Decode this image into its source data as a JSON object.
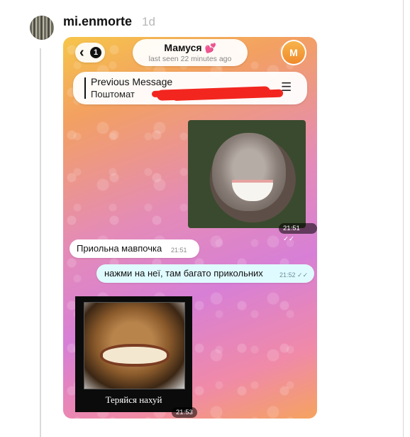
{
  "post": {
    "username": "mi.enmorte",
    "age": "1d"
  },
  "chat": {
    "back_badge": "1",
    "title": "Мамуся",
    "title_emoji": "💕",
    "last_seen": "last seen 22 minutes ago",
    "contact_initial": "M",
    "pinned": {
      "title": "Previous Message",
      "text": "Поштомат"
    },
    "messages": [
      {
        "type": "image",
        "direction": "in",
        "time": "21:51",
        "status": "read"
      },
      {
        "type": "text",
        "direction": "in",
        "text": "Приольна мавпочка",
        "time": "21:51"
      },
      {
        "type": "text",
        "direction": "out",
        "text": "нажми на неї, там багато прикольних",
        "time": "21:52",
        "status": "read"
      },
      {
        "type": "image",
        "direction": "in",
        "caption": "Теряйся нахуй",
        "time": "21:53"
      }
    ]
  },
  "colors": {
    "outgoing_bubble": "#e0fbff",
    "incoming_bubble": "#ffffff",
    "contact_avatar": "#f29a37",
    "redaction": "#f2261f"
  }
}
